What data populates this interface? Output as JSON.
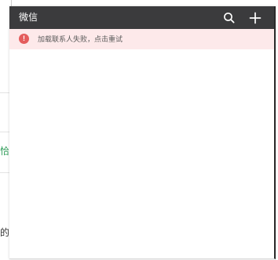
{
  "window": {
    "title": "微信"
  },
  "toolbar": {
    "search_icon": "search-icon",
    "add_icon": "plus-icon"
  },
  "alert": {
    "icon_glyph": "!",
    "message": "加载联系人失败，点击重试",
    "background": "#fde9ea",
    "icon_color": "#e45c5c"
  },
  "background_app": {
    "fragment_green": "恰",
    "fragment_dark": "的"
  },
  "colors": {
    "titlebar": "#3b3b3d",
    "title_text": "#ffffff"
  }
}
